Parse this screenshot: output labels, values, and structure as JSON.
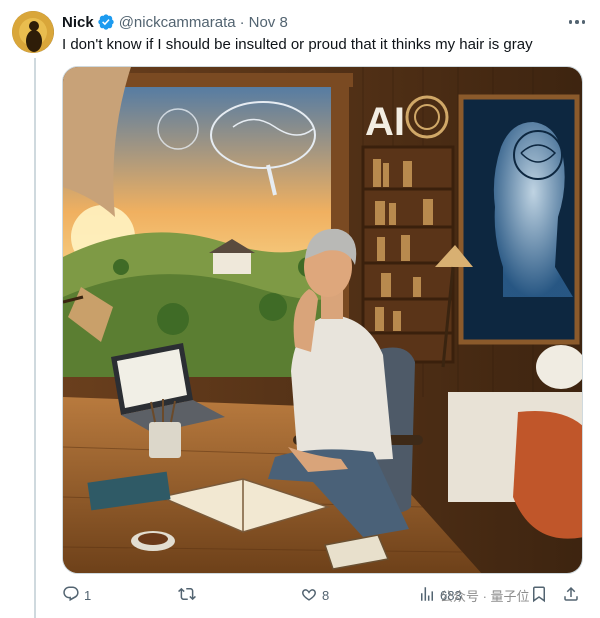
{
  "tweet": {
    "author_name": "Nick",
    "handle": "@nickcammarata",
    "separator": "·",
    "date": "Nov 8",
    "text": "I don't know if I should be insulted or proud that it thinks my hair is gray",
    "media_text": "AI"
  },
  "actions": {
    "replies": "1",
    "likes": "8",
    "views": "683"
  },
  "watermark": {
    "text": "公众号 · 量子位"
  },
  "icons": {
    "verified": "verified-badge-icon",
    "more": "more-options-icon",
    "reply": "reply-icon",
    "retweet": "retweet-icon",
    "like": "like-icon",
    "views": "views-icon",
    "share": "share-icon"
  },
  "colors": {
    "verified_blue": "#1d9bf0",
    "text_primary": "#0f1419",
    "text_secondary": "#536471",
    "border": "#cfd9de"
  }
}
